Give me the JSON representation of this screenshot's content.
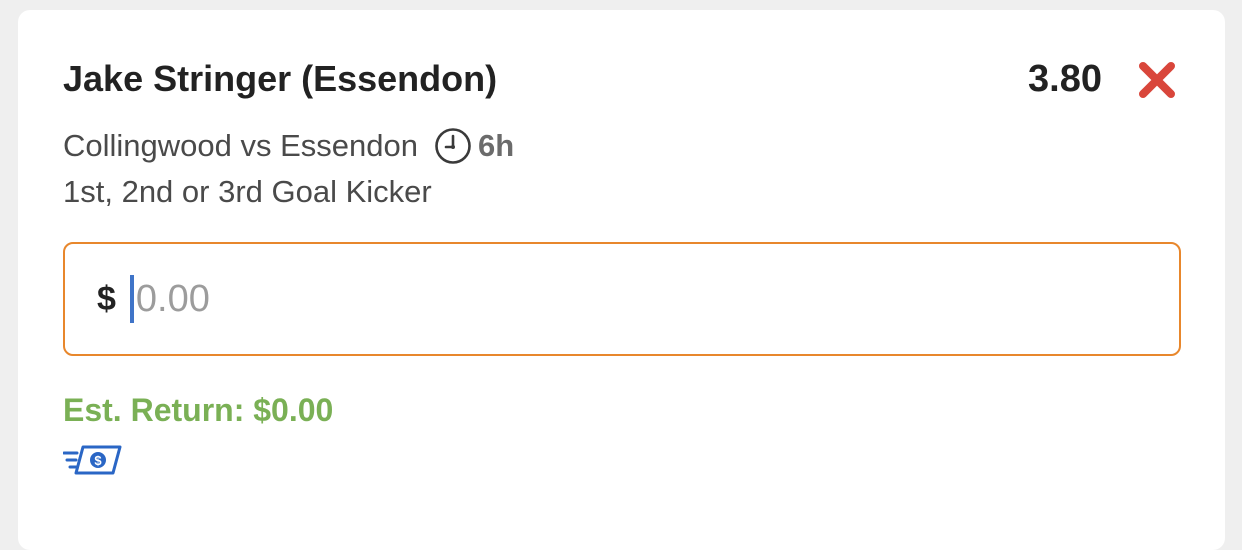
{
  "bet": {
    "selection": "Jake Stringer (Essendon)",
    "odds": "3.80",
    "match": "Collingwood vs Essendon",
    "time_to_start": "6h",
    "market": "1st, 2nd or 3rd Goal Kicker"
  },
  "stake": {
    "currency_symbol": "$",
    "value": "",
    "placeholder": "0.00"
  },
  "est_return_text": "Est. Return: $0.00",
  "icons": {
    "remove": "close-x-icon",
    "clock": "clock-icon",
    "cash": "fast-cash-icon"
  },
  "colors": {
    "remove_red": "#d9463b",
    "input_border_orange": "#e8872c",
    "est_return_green": "#7ab055",
    "caret_blue": "#3f74c8",
    "cash_icon_blue": "#2a66c5"
  }
}
